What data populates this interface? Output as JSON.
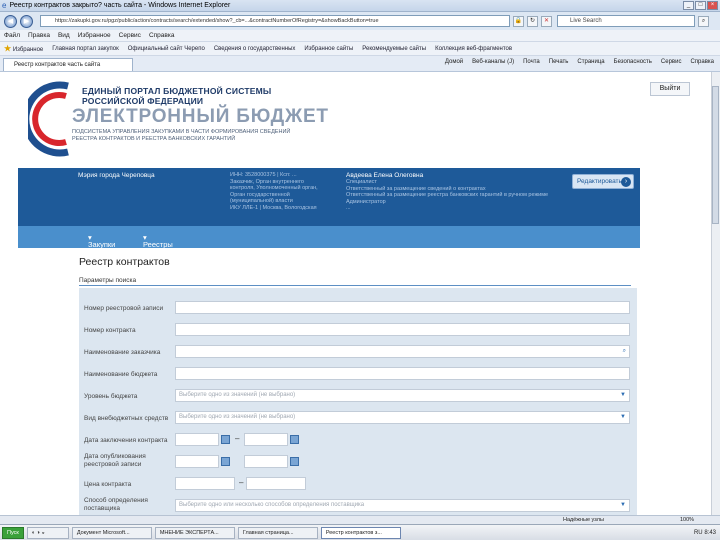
{
  "window": {
    "title": "Реестр контрактов закрыто? часть сайта - Windows Internet Explorer",
    "controls": [
      "_",
      "□",
      "×"
    ]
  },
  "address": {
    "url": "https://zakupki.gov.ru/pgz/public/action/contracts/search/extended/show?_cb=...&contractNumberOfRegistry=&showBackButton=true",
    "search": "Live Search"
  },
  "menu": [
    "Файл",
    "Правка",
    "Вид",
    "Избранное",
    "Сервис",
    "Справка"
  ],
  "favorites": [
    "Избранное",
    "Главная портал закупок",
    "Официальный сайт Черепо",
    "Сведения о государственных",
    "Избранное сайты",
    "Рекомендуемые сайты",
    "Коллекция веб-фрагментов"
  ],
  "tab": {
    "label": "Реестр контрактов часть сайта"
  },
  "commands": [
    "Домой",
    "Веб-каналы (J)",
    "Почта",
    "Печать",
    "Страница",
    "Безопасность",
    "Сервис",
    "Справка"
  ],
  "logo": {
    "line1": "ЕДИНЫЙ ПОРТАЛ БЮДЖЕТНОЙ СИСТЕМЫ",
    "line2": "РОССИЙСКОЙ ФЕДЕРАЦИИ",
    "name": "ЭЛЕКТРОННЫЙ БЮДЖЕТ",
    "sub1": "ПОДСИСТЕМА УПРАВЛЕНИЯ ЗАКУПКАМИ В ЧАСТИ ФОРМИРОВАНИЯ СВЕДЕНИЙ",
    "sub2": "РЕЕСТРА КОНТРАКТОВ И РЕЕСТРА БАНКОВСКИХ ГАРАНТИЙ"
  },
  "exit_label": "Выйти",
  "org": {
    "name": "Мэрия города Череповца",
    "inn": "ИНН: 3528000375 | Ксп: ...",
    "role1": "Заказчик, Орган внутреннего",
    "role2": "контроля, Уполномоченный орган,",
    "role3": "Орган государственной",
    "role4": "(муниципальной) власти",
    "addr": "ИКУ ЛЛЕ-1 | Москва, Вологодская"
  },
  "user": {
    "name": "Авдеева Елена Олеговна",
    "position": "Специалист",
    "line1": "Ответственный за размещение сведений о контрактах",
    "line2": "Ответственный за размещение реестра банковских гарантий в ручном режиме",
    "line3": "Администратор",
    "line4": "..."
  },
  "send_button": "Редактировать",
  "nav": {
    "item1": "Закупки",
    "item2": "Реестры"
  },
  "page_title": "Реестр контрактов",
  "params_label": "Параметры поиска",
  "fields": [
    {
      "label": "Номер реестровой записи",
      "value": ""
    },
    {
      "label": "Номер контракта",
      "value": ""
    },
    {
      "label": "Наименование заказчика",
      "value": ""
    },
    {
      "label": "Наименование бюджета",
      "value": ""
    },
    {
      "label": "Уровень бюджета",
      "value": "Выберите одно из значений (не выбрано)"
    },
    {
      "label": "Вид внебюджетных средств",
      "value": "Выберите одно из значений (не выбрано)"
    },
    {
      "label": "Дата заключения контракта",
      "value": ""
    },
    {
      "label": "Дата опубликования реестровой записи",
      "value": ""
    },
    {
      "label": "Цена контракта",
      "value": ""
    },
    {
      "label": "Способ определения поставщика",
      "value": "Выберите одно или несколько способов определения поставщика"
    }
  ],
  "status": {
    "zone": "Надёжные узлы",
    "zoom": "100%"
  },
  "taskbar": {
    "start": "Пуск",
    "items": [
      "Документ Microsoft...",
      "МНЕНИЕ ЭКСПЕРТА...",
      "Главная страница...",
      "Реестр контрактов з..."
    ],
    "tray": "RU",
    "clock": "8:43"
  }
}
